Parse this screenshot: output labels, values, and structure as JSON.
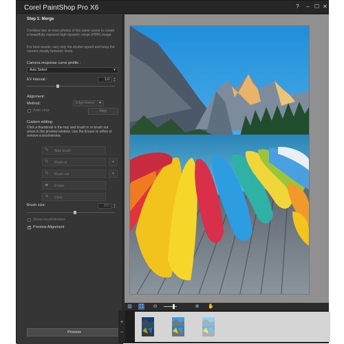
{
  "window": {
    "title": "Corel PaintShop Pro X6",
    "controls": {
      "help": "?",
      "minimize": "–",
      "maximize": "☐",
      "close": "✕"
    }
  },
  "panel": {
    "step_title": "Step 1: Merge",
    "description": "Combine two or more photos of the same scene to create a beautifully exposed high dynamic range (HDR) image.",
    "tip": "For best results, vary only the shutter speed and keep the camera steady between shots.",
    "crc_label": "Camera response curve profile :",
    "crc_value": "Auto Select",
    "ev_label": "EV interval :",
    "ev_value": "1.0",
    "ev_slider_fraction": 0.35,
    "alignment_heading": "Alignment:",
    "method_label": "Method:",
    "method_value": "Edge-based",
    "auto_crop_label": "Auto crop",
    "align_button": "Align",
    "custom_heading": "Custom editing:",
    "custom_desc": "Click a thumbnail in the tray and brush in or brush out areas in the preview window. Use the Eraser to refine or remove a brushstroke.",
    "tools": [
      {
        "label": "Auto brush",
        "icon": "auto-brush-icon"
      },
      {
        "label": "Brush in",
        "icon": "brush-in-icon"
      },
      {
        "label": "Brush out",
        "icon": "brush-out-icon"
      },
      {
        "label": "Eraser",
        "icon": "eraser-icon"
      },
      {
        "label": "Clear",
        "icon": "clear-icon"
      }
    ],
    "brush_size_label": "Brush size:",
    "brush_size_value": "200",
    "brush_slider_fraction": 0.55,
    "show_strokes_label": "Show brushstrokes",
    "preview_alignment_label": "Preview Alignment",
    "preview_alignment_checked": true,
    "process_button": "Process"
  },
  "tray": {
    "add": "+",
    "remove": "−",
    "thumbnail_count": 3
  },
  "colors": {
    "window": "#2f2f2f",
    "panel": "#353535",
    "preview_bg": "#909090",
    "accent": "#3f6d9b"
  }
}
